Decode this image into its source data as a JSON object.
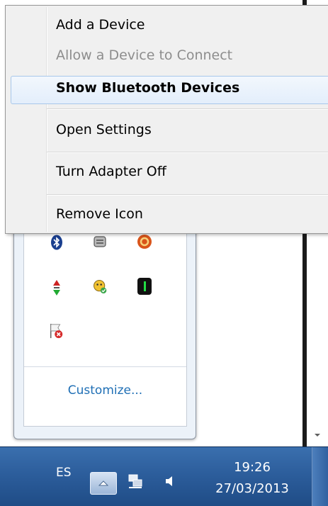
{
  "context_menu": {
    "items": [
      {
        "label": "Add a Device",
        "state": "normal"
      },
      {
        "label": "Allow a Device to Connect",
        "state": "disabled"
      },
      {
        "label": "Show Bluetooth Devices",
        "state": "default-highlighted"
      },
      {
        "label": "Open Settings",
        "state": "normal"
      },
      {
        "label": "Turn Adapter Off",
        "state": "normal"
      },
      {
        "label": "Remove Icon",
        "state": "normal"
      }
    ]
  },
  "tray_flyout": {
    "icons": [
      "bluetooth-icon",
      "network-drive-icon",
      "orange-app-icon",
      "updown-arrows-icon",
      "messenger-icon",
      "green-digit-icon",
      "flag-error-icon"
    ],
    "customize_label": "Customize..."
  },
  "taskbar": {
    "language": "ES",
    "time": "19:26",
    "date": "27/03/2013"
  },
  "colors": {
    "taskbar": "#2b5c9a",
    "link": "#1f6fb5",
    "highlight_border": "#a8c7ea"
  }
}
